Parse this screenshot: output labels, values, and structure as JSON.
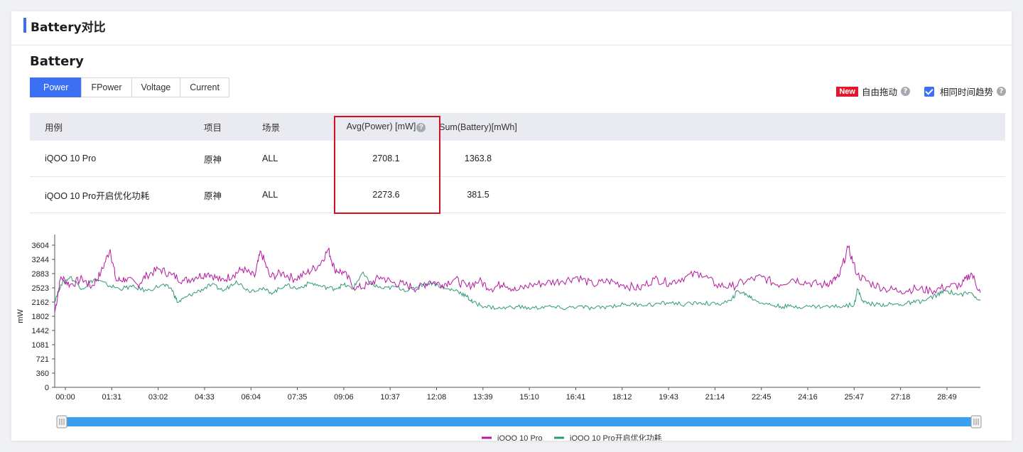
{
  "header": {
    "title": "Battery对比"
  },
  "section": {
    "title": "Battery"
  },
  "tabs": [
    "Power",
    "FPower",
    "Voltage",
    "Current"
  ],
  "active_tab": "Power",
  "options": {
    "new_badge": "New",
    "free_drag_label": "自由拖动",
    "same_time_trend_label": "相同时间趋势",
    "same_time_trend_checked": true
  },
  "table": {
    "headers": [
      "用例",
      "项目",
      "场景",
      "Avg(Power) [mW]",
      "Sum(Battery)[mWh]"
    ],
    "rows": [
      [
        "iQOO 10 Pro",
        "原神",
        "ALL",
        "2708.1",
        "1363.8"
      ],
      [
        "iQOO 10 Pro开启优化功耗",
        "原神",
        "ALL",
        "2273.6",
        "381.5"
      ]
    ]
  },
  "colors": {
    "accent": "#3b70f5",
    "highlight": "#d4111c",
    "series1": "#b5199f",
    "series2": "#2f9a78"
  },
  "chart_data": {
    "type": "line",
    "ylabel": "mW",
    "ylim": [
      0,
      3604
    ],
    "yticks": [
      0,
      360,
      721,
      1081,
      1442,
      1802,
      2162,
      2523,
      2883,
      3244,
      3604
    ],
    "xticks": [
      "00:00",
      "01:31",
      "03:02",
      "04:33",
      "06:04",
      "07:35",
      "09:06",
      "10:37",
      "12:08",
      "13:39",
      "15:10",
      "16:41",
      "18:12",
      "19:43",
      "21:14",
      "22:45",
      "24:16",
      "25:47",
      "27:18",
      "28:49"
    ],
    "x_range_minutes": [
      0,
      30.1
    ],
    "legend_position": "bottom",
    "series": [
      {
        "name": "iQOO 10 Pro",
        "points": [
          [
            0,
            1900
          ],
          [
            0.2,
            2800
          ],
          [
            0.5,
            2600
          ],
          [
            0.9,
            2750
          ],
          [
            1.2,
            2550
          ],
          [
            1.5,
            2900
          ],
          [
            1.8,
            3500
          ],
          [
            2.0,
            2700
          ],
          [
            2.3,
            2750
          ],
          [
            2.7,
            2600
          ],
          [
            3.0,
            2850
          ],
          [
            3.4,
            3000
          ],
          [
            3.8,
            2850
          ],
          [
            4.2,
            2700
          ],
          [
            4.6,
            2800
          ],
          [
            5.0,
            2900
          ],
          [
            5.4,
            2700
          ],
          [
            5.8,
            2850
          ],
          [
            6.1,
            3000
          ],
          [
            6.5,
            2800
          ],
          [
            6.7,
            3450
          ],
          [
            7.0,
            2800
          ],
          [
            7.4,
            2900
          ],
          [
            7.8,
            2750
          ],
          [
            8.2,
            2900
          ],
          [
            8.6,
            3100
          ],
          [
            8.9,
            3500
          ],
          [
            9.1,
            3000
          ],
          [
            9.4,
            2900
          ],
          [
            9.8,
            2500
          ],
          [
            10.2,
            2600
          ],
          [
            10.6,
            2800
          ],
          [
            11.0,
            2650
          ],
          [
            11.4,
            2600
          ],
          [
            11.8,
            2500
          ],
          [
            12.2,
            2700
          ],
          [
            12.6,
            2600
          ],
          [
            13.0,
            2750
          ],
          [
            13.4,
            2550
          ],
          [
            13.8,
            2700
          ],
          [
            14.2,
            2500
          ],
          [
            14.6,
            2650
          ],
          [
            15.0,
            2450
          ],
          [
            15.5,
            2600
          ],
          [
            16.0,
            2650
          ],
          [
            16.5,
            2700
          ],
          [
            17.0,
            2800
          ],
          [
            17.5,
            2600
          ],
          [
            18.0,
            2700
          ],
          [
            18.5,
            2600
          ],
          [
            19.0,
            2500
          ],
          [
            19.5,
            2750
          ],
          [
            20.0,
            2650
          ],
          [
            20.5,
            2800
          ],
          [
            21.0,
            2900
          ],
          [
            21.5,
            2600
          ],
          [
            22.0,
            2550
          ],
          [
            22.5,
            2700
          ],
          [
            23.0,
            2800
          ],
          [
            23.5,
            2600
          ],
          [
            24.0,
            2750
          ],
          [
            24.5,
            2650
          ],
          [
            25.0,
            2600
          ],
          [
            25.3,
            2700
          ],
          [
            25.5,
            2800
          ],
          [
            25.8,
            3550
          ],
          [
            26.1,
            2850
          ],
          [
            26.5,
            2650
          ],
          [
            27.0,
            2500
          ],
          [
            27.5,
            2450
          ],
          [
            28.0,
            2500
          ],
          [
            28.5,
            2450
          ],
          [
            29.0,
            2550
          ],
          [
            29.5,
            2600
          ],
          [
            29.8,
            2900
          ],
          [
            30.1,
            2400
          ]
        ]
      },
      {
        "name": "iQOO 10 Pro开启优化功耗",
        "points": [
          [
            0,
            2200
          ],
          [
            0.2,
            2600
          ],
          [
            0.5,
            2800
          ],
          [
            0.9,
            2500
          ],
          [
            1.3,
            2750
          ],
          [
            1.7,
            2600
          ],
          [
            2.1,
            2500
          ],
          [
            2.5,
            2550
          ],
          [
            3.0,
            2450
          ],
          [
            3.5,
            2600
          ],
          [
            3.8,
            2500
          ],
          [
            4.0,
            2150
          ],
          [
            4.3,
            2300
          ],
          [
            4.7,
            2450
          ],
          [
            5.1,
            2600
          ],
          [
            5.5,
            2450
          ],
          [
            5.9,
            2700
          ],
          [
            6.3,
            2450
          ],
          [
            6.7,
            2500
          ],
          [
            7.1,
            2400
          ],
          [
            7.5,
            2600
          ],
          [
            7.9,
            2500
          ],
          [
            8.3,
            2650
          ],
          [
            8.7,
            2550
          ],
          [
            9.1,
            2500
          ],
          [
            9.4,
            2600
          ],
          [
            9.7,
            2500
          ],
          [
            10.0,
            2900
          ],
          [
            10.3,
            2600
          ],
          [
            10.7,
            2500
          ],
          [
            11.1,
            2550
          ],
          [
            11.5,
            2450
          ],
          [
            11.9,
            2600
          ],
          [
            12.3,
            2650
          ],
          [
            12.7,
            2500
          ],
          [
            13.1,
            2450
          ],
          [
            13.4,
            2300
          ],
          [
            13.6,
            2150
          ],
          [
            14.0,
            2050
          ],
          [
            14.5,
            2000
          ],
          [
            15.0,
            2050
          ],
          [
            15.5,
            2000
          ],
          [
            16.0,
            2050
          ],
          [
            16.5,
            2000
          ],
          [
            17.0,
            2050
          ],
          [
            17.5,
            2000
          ],
          [
            18.0,
            2050
          ],
          [
            18.5,
            2100
          ],
          [
            19.0,
            2100
          ],
          [
            19.5,
            2100
          ],
          [
            20.0,
            2150
          ],
          [
            20.5,
            2100
          ],
          [
            21.0,
            2150
          ],
          [
            21.5,
            2100
          ],
          [
            22.0,
            2200
          ],
          [
            22.2,
            2450
          ],
          [
            22.5,
            2350
          ],
          [
            22.8,
            2200
          ],
          [
            23.2,
            2100
          ],
          [
            23.6,
            2050
          ],
          [
            24.0,
            2050
          ],
          [
            24.5,
            2050
          ],
          [
            25.0,
            2050
          ],
          [
            25.5,
            2050
          ],
          [
            26.0,
            2100
          ],
          [
            26.1,
            2500
          ],
          [
            26.3,
            2150
          ],
          [
            26.7,
            2100
          ],
          [
            27.1,
            2100
          ],
          [
            27.5,
            2100
          ],
          [
            27.9,
            2150
          ],
          [
            28.3,
            2200
          ],
          [
            28.7,
            2350
          ],
          [
            29.0,
            2450
          ],
          [
            29.4,
            2350
          ],
          [
            29.8,
            2400
          ],
          [
            30.1,
            2200
          ]
        ]
      }
    ]
  }
}
